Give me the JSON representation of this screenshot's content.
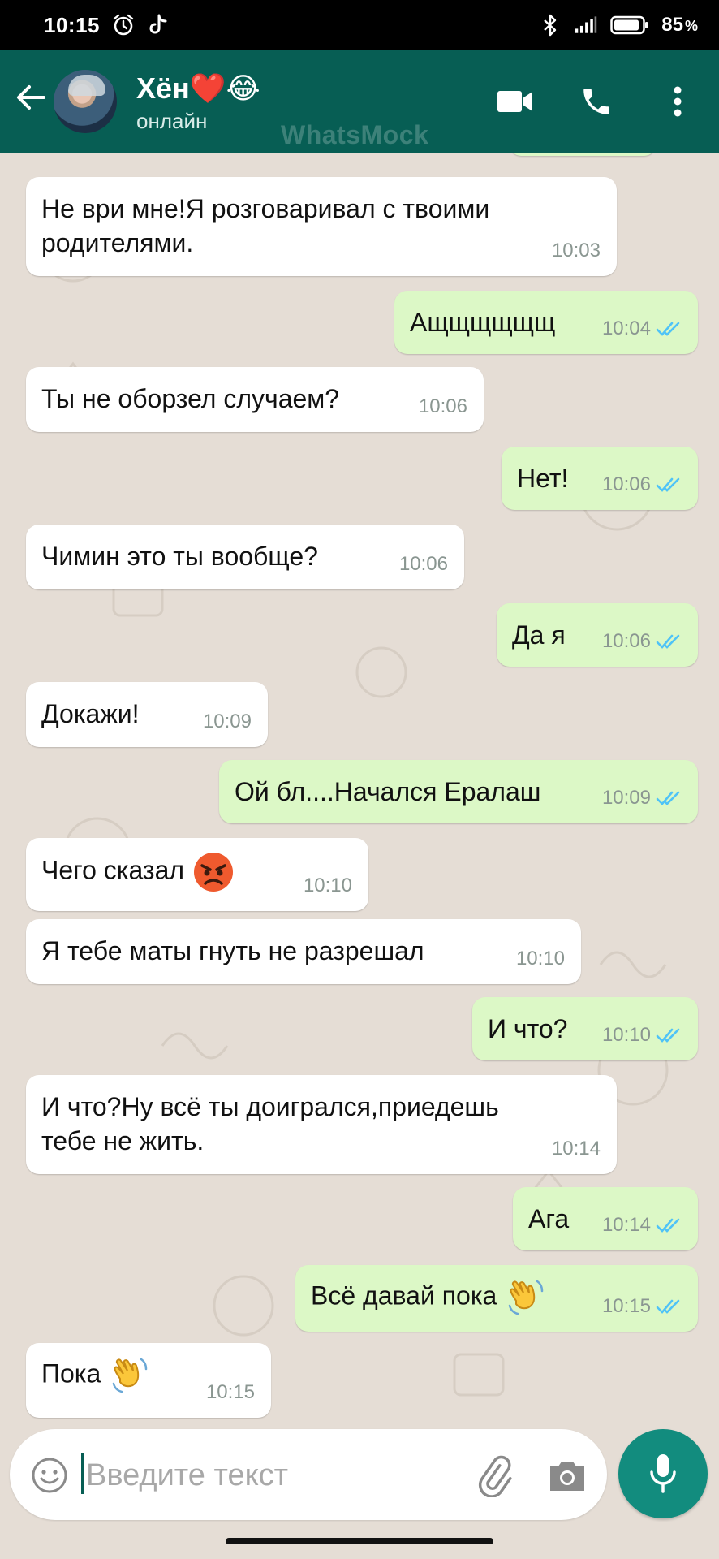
{
  "status_bar": {
    "time": "10:15",
    "battery": "85",
    "battery_unit": "%",
    "icons": [
      "alarm-icon",
      "tiktok-icon",
      "bluetooth-icon",
      "signal-icon",
      "battery-icon"
    ]
  },
  "header": {
    "contact_name": "Хён❤️😂",
    "status": "онлайн",
    "watermark": "WhatsMock",
    "icons": [
      "back-arrow-icon",
      "video-call-icon",
      "phone-icon",
      "more-vert-icon"
    ],
    "color": "#075e54"
  },
  "messages": [
    {
      "dir": "in",
      "text": "Не ври мне!Я розговаривал с твоими родителями.",
      "time": "10:03"
    },
    {
      "dir": "out",
      "text": "Ащщщщщщ",
      "time": "10:04",
      "read": true
    },
    {
      "dir": "in",
      "text": "Ты не оборзел случаем?",
      "time": "10:06"
    },
    {
      "dir": "out",
      "text": "Нет!",
      "time": "10:06",
      "read": true
    },
    {
      "dir": "in",
      "text": "Чимин это ты вообще?",
      "time": "10:06"
    },
    {
      "dir": "out",
      "text": "Да я",
      "time": "10:06",
      "read": true
    },
    {
      "dir": "in",
      "text": "Докажи!",
      "time": "10:09"
    },
    {
      "dir": "out",
      "text": "Ой бл....Начался Ералаш",
      "time": "10:09",
      "read": true
    },
    {
      "dir": "in",
      "text": "Чего сказал",
      "emoji": "angry-face-emoji",
      "time": "10:10"
    },
    {
      "dir": "in",
      "text": "Я тебе маты гнуть не разрешал",
      "time": "10:10"
    },
    {
      "dir": "out",
      "text": "И что?",
      "time": "10:10",
      "read": true
    },
    {
      "dir": "in",
      "text": "И что?Ну всё ты доигрался,приедешь тебе не жить.",
      "time": "10:14"
    },
    {
      "dir": "out",
      "text": "Ага",
      "time": "10:14",
      "read": true
    },
    {
      "dir": "out",
      "text": "Всё давай пока",
      "emoji": "waving-hand-emoji",
      "time": "10:15",
      "read": true
    },
    {
      "dir": "in",
      "text": "Пока",
      "emoji": "waving-hand-emoji",
      "time": "10:15"
    }
  ],
  "input": {
    "placeholder": "Введите текст",
    "value": "",
    "icons": [
      "smiley-icon",
      "attach-icon",
      "camera-icon",
      "mic-icon"
    ]
  },
  "colors": {
    "incoming_bubble": "#ffffff",
    "outgoing_bubble": "#dcf8c6",
    "chat_background": "#e5ddd5",
    "read_ticks": "#4fc3f7",
    "mic_button": "#128c7e"
  }
}
